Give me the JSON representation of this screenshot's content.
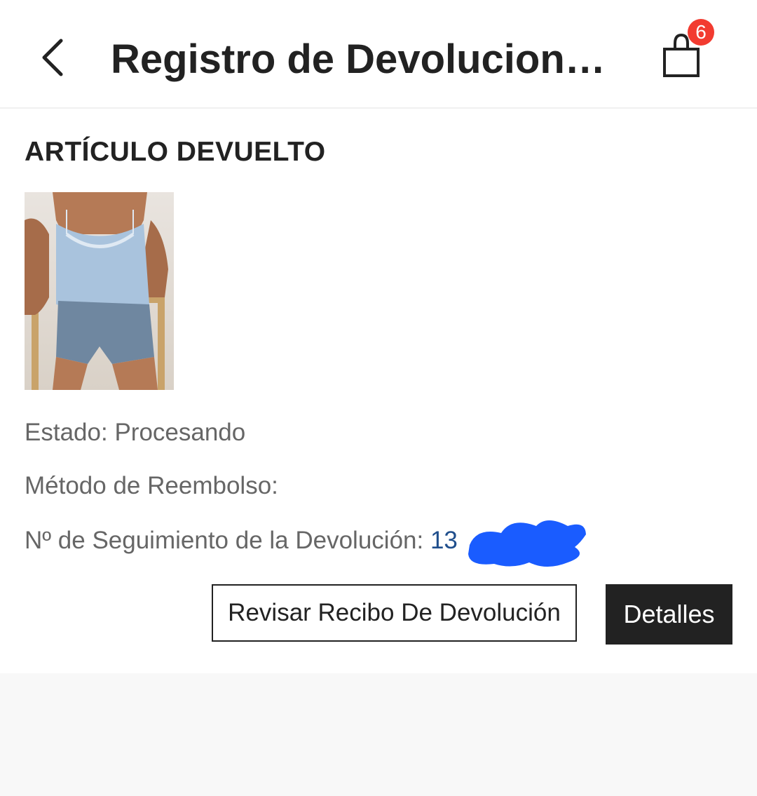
{
  "header": {
    "title": "Registro de Devoluciones...",
    "cart_count": "6"
  },
  "returned_item": {
    "section_title": "ARTÍCULO DEVUELTO",
    "status_label": "Estado:",
    "status_value": "Procesando",
    "refund_method_label": "Método de Reembolso:",
    "tracking_label": "Nº de Seguimiento de la Devolución:",
    "tracking_value_visible": "13"
  },
  "actions": {
    "review_receipt_label": "Revisar Recibo De Devolución",
    "details_label": "Detalles"
  },
  "colors": {
    "badge": "#f23b30",
    "primary_button": "#222222",
    "tracking_link": "#1f4e8c",
    "redaction": "#1a5cff"
  },
  "icons": {
    "back": "chevron-left-icon",
    "cart": "shopping-bag-icon"
  }
}
